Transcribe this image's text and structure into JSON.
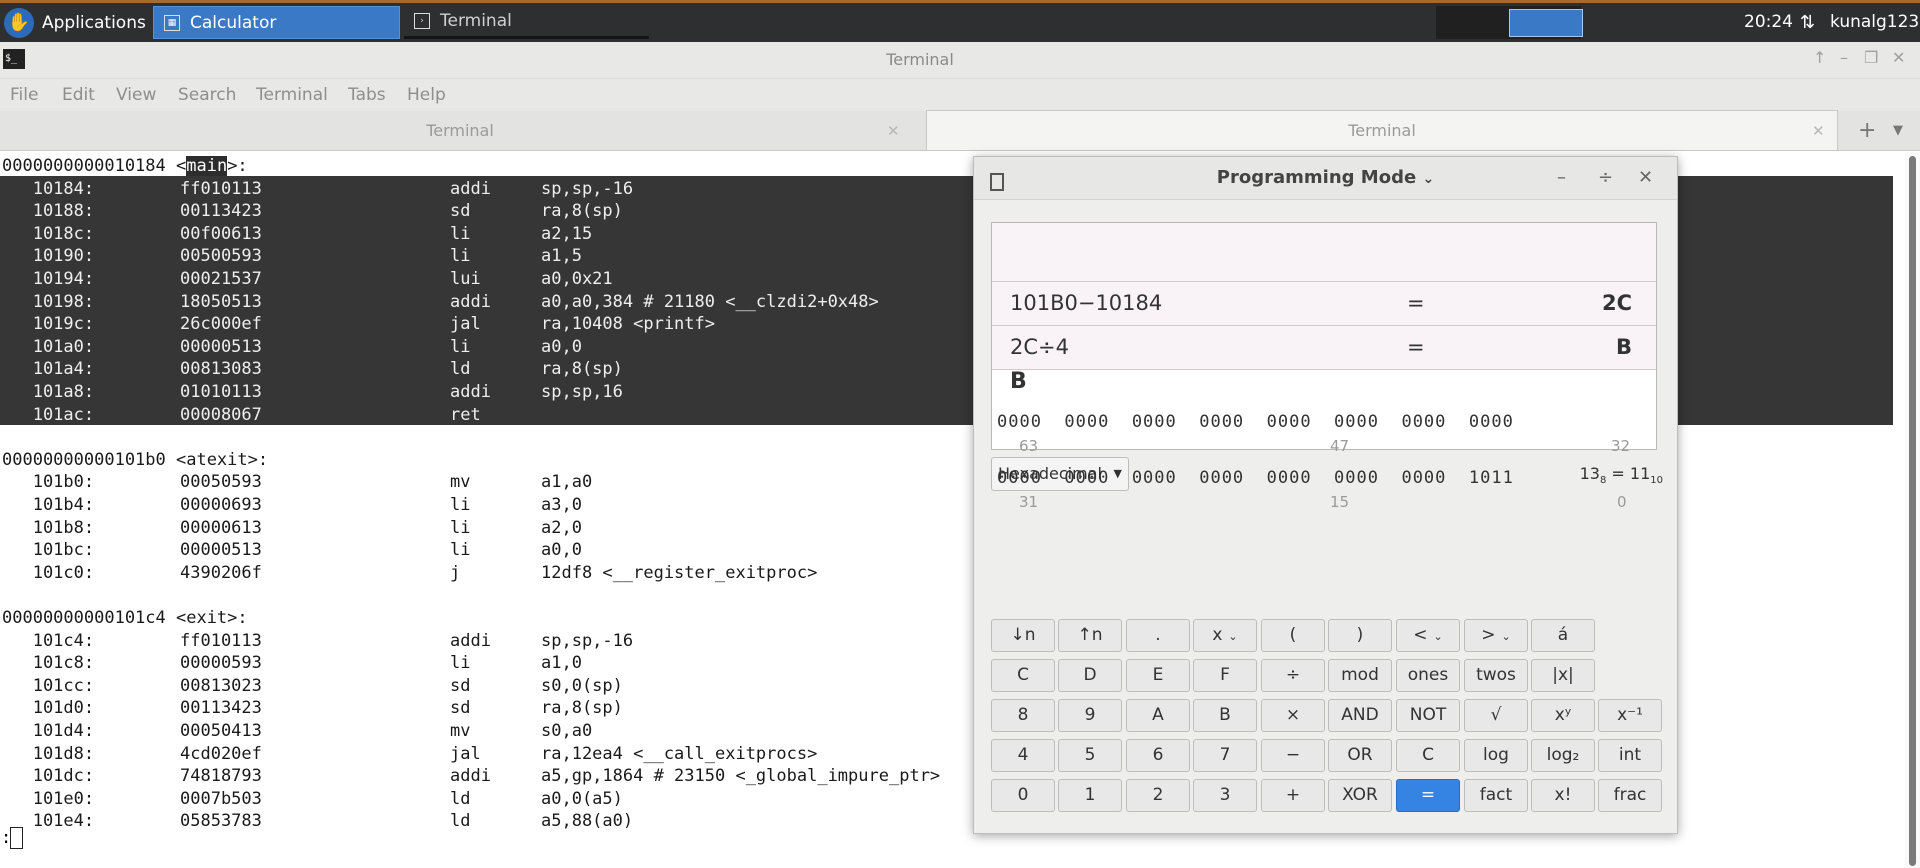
{
  "panel": {
    "applications": "Applications",
    "tasks": [
      {
        "label": "Calculator"
      },
      {
        "label": "Terminal"
      }
    ],
    "clock": "20:24",
    "user": "kunalg123"
  },
  "terminal": {
    "title": "Terminal",
    "menu": [
      "File",
      "Edit",
      "View",
      "Search",
      "Terminal",
      "Tabs",
      "Help"
    ],
    "tabs": [
      {
        "label": "Terminal"
      },
      {
        "label": "Terminal"
      }
    ],
    "lines": [
      {
        "addr": "0000000000010184 <main>:",
        "code": "",
        "mnem": "",
        "args": ""
      },
      {
        "addr": "   10184:",
        "code": "ff010113",
        "mnem": "addi",
        "args": "sp,sp,-16"
      },
      {
        "addr": "   10188:",
        "code": "00113423",
        "mnem": "sd",
        "args": "ra,8(sp)"
      },
      {
        "addr": "   1018c:",
        "code": "00f00613",
        "mnem": "li",
        "args": "a2,15"
      },
      {
        "addr": "   10190:",
        "code": "00500593",
        "mnem": "li",
        "args": "a1,5"
      },
      {
        "addr": "   10194:",
        "code": "00021537",
        "mnem": "lui",
        "args": "a0,0x21"
      },
      {
        "addr": "   10198:",
        "code": "18050513",
        "mnem": "addi",
        "args": "a0,a0,384 # 21180 <__clzdi2+0x48>"
      },
      {
        "addr": "   1019c:",
        "code": "26c000ef",
        "mnem": "jal",
        "args": "ra,10408 <printf>"
      },
      {
        "addr": "   101a0:",
        "code": "00000513",
        "mnem": "li",
        "args": "a0,0"
      },
      {
        "addr": "   101a4:",
        "code": "00813083",
        "mnem": "ld",
        "args": "ra,8(sp)"
      },
      {
        "addr": "   101a8:",
        "code": "01010113",
        "mnem": "addi",
        "args": "sp,sp,16"
      },
      {
        "addr": "   101ac:",
        "code": "00008067",
        "mnem": "ret",
        "args": ""
      },
      {
        "addr": "",
        "code": "",
        "mnem": "",
        "args": ""
      },
      {
        "addr": "00000000000101b0 <atexit>:",
        "code": "",
        "mnem": "",
        "args": ""
      },
      {
        "addr": "   101b0:",
        "code": "00050593",
        "mnem": "mv",
        "args": "a1,a0"
      },
      {
        "addr": "   101b4:",
        "code": "00000693",
        "mnem": "li",
        "args": "a3,0"
      },
      {
        "addr": "   101b8:",
        "code": "00000613",
        "mnem": "li",
        "args": "a2,0"
      },
      {
        "addr": "   101bc:",
        "code": "00000513",
        "mnem": "li",
        "args": "a0,0"
      },
      {
        "addr": "   101c0:",
        "code": "4390206f",
        "mnem": "j",
        "args": "12df8 <__register_exitproc>"
      },
      {
        "addr": "",
        "code": "",
        "mnem": "",
        "args": ""
      },
      {
        "addr": "00000000000101c4 <exit>:",
        "code": "",
        "mnem": "",
        "args": ""
      },
      {
        "addr": "   101c4:",
        "code": "ff010113",
        "mnem": "addi",
        "args": "sp,sp,-16"
      },
      {
        "addr": "   101c8:",
        "code": "00000593",
        "mnem": "li",
        "args": "a1,0"
      },
      {
        "addr": "   101cc:",
        "code": "00813023",
        "mnem": "sd",
        "args": "s0,0(sp)"
      },
      {
        "addr": "   101d0:",
        "code": "00113423",
        "mnem": "sd",
        "args": "ra,8(sp)"
      },
      {
        "addr": "   101d4:",
        "code": "00050413",
        "mnem": "mv",
        "args": "s0,a0"
      },
      {
        "addr": "   101d8:",
        "code": "4cd020ef",
        "mnem": "jal",
        "args": "ra,12ea4 <__call_exitprocs>"
      },
      {
        "addr": "   101dc:",
        "code": "74818793",
        "mnem": "addi",
        "args": "a5,gp,1864 # 23150 <_global_impure_ptr>"
      },
      {
        "addr": "   101e0:",
        "code": "0007b503",
        "mnem": "ld",
        "args": "a0,0(a5)"
      },
      {
        "addr": "   101e4:",
        "code": "05853783",
        "mnem": "ld",
        "args": "a5,88(a0)"
      }
    ],
    "prompt": ":"
  },
  "calculator": {
    "mode": "Programming Mode",
    "history": [
      {
        "expr": "101B0−10184",
        "eq": "=",
        "result": "2C"
      },
      {
        "expr": "2C÷4",
        "eq": "=",
        "result": "B"
      }
    ],
    "entry": "B",
    "base": "Hexadecimal",
    "conversion": {
      "a": "13",
      "a_base": "8",
      "eq": " = ",
      "b": "11",
      "b_base": "10"
    },
    "bits_high": "0000  0000  0000  0000  0000  0000  0000  0000",
    "bits_high_labels": [
      "63",
      "47",
      "32"
    ],
    "bits_low": "0000  0000  0000  0000  0000  0000  0000  1011",
    "bits_low_labels": [
      "31",
      "15",
      "0"
    ],
    "buttons": [
      [
        "↓n",
        "↑n",
        ".",
        "x",
        "(",
        ")",
        "<",
        ">",
        "á"
      ],
      [
        "C",
        "D",
        "E",
        "F",
        "÷",
        "mod",
        "ones",
        "twos",
        "|x|"
      ],
      [
        "8",
        "9",
        "A",
        "B",
        "×",
        "AND",
        "NOT",
        "√",
        "xʸ",
        "x⁻¹"
      ],
      [
        "4",
        "5",
        "6",
        "7",
        "−",
        "OR",
        "C",
        "log",
        "log₂",
        "int"
      ],
      [
        "0",
        "1",
        "2",
        "3",
        "+",
        "XOR",
        "=",
        "fact",
        "x!",
        "frac"
      ]
    ]
  },
  "colors": {
    "accent": "#3584e4",
    "panel": "#2e2f30",
    "selection": "#363636"
  }
}
